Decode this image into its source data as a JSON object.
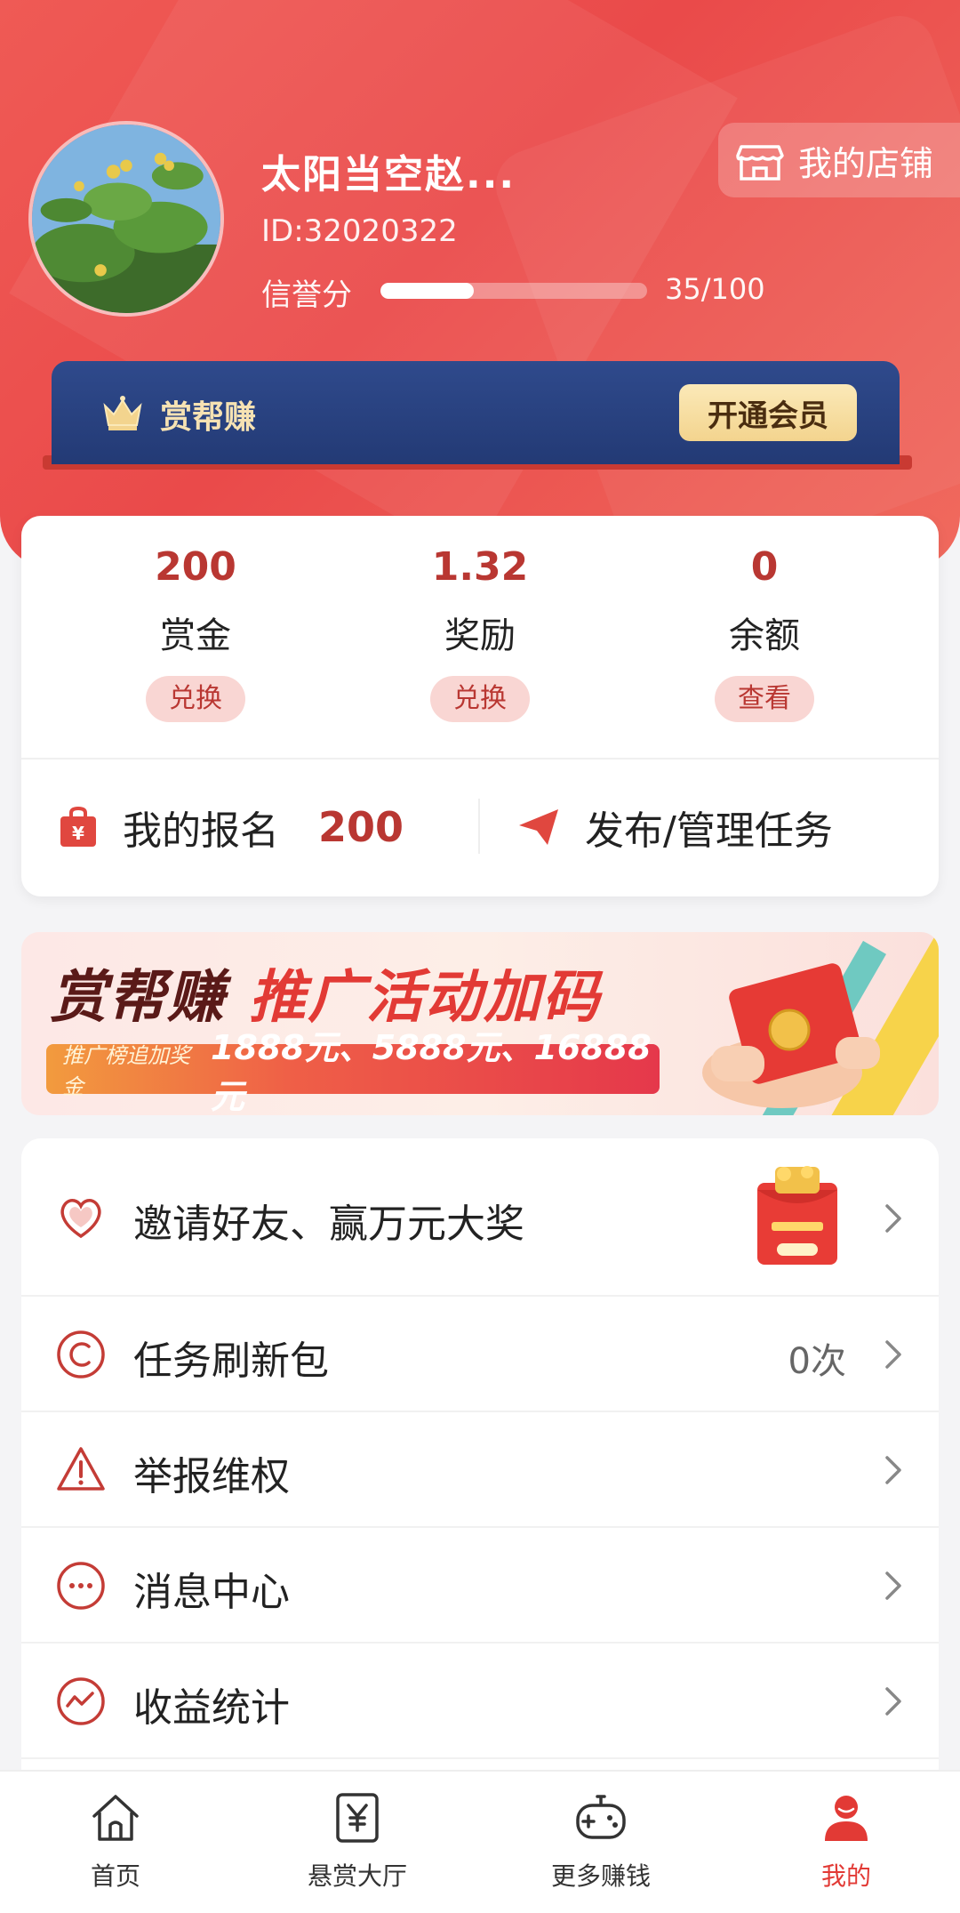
{
  "profile": {
    "username": "太阳当空赵...",
    "user_id": "ID:32020322",
    "credit_label": "信誉分",
    "credit_score": 35,
    "credit_max": 100,
    "credit_text": "35/100",
    "store_label": "我的店铺"
  },
  "vip": {
    "name": "赏帮赚",
    "button_label": "开通会员"
  },
  "stats": [
    {
      "value": "200",
      "label": "赏金",
      "action": "兑换"
    },
    {
      "value": "1.32",
      "label": "奖励",
      "action": "兑换"
    },
    {
      "value": "0",
      "label": "余额",
      "action": "查看"
    }
  ],
  "signup": {
    "label": "我的报名",
    "count": "200"
  },
  "publish": {
    "label": "发布/管理任务"
  },
  "promo": {
    "title_a": "赏帮赚",
    "title_b": "推广活动加码",
    "sub_prefix": "推广榜追加奖金",
    "sub_amounts": "1888元、5888元、16888元"
  },
  "menu": [
    {
      "label": "邀请好友、赢万元大奖",
      "value": "",
      "icon": "heart-icon"
    },
    {
      "label": "任务刷新包",
      "value": "0次",
      "icon": "refresh-icon"
    },
    {
      "label": "举报维权",
      "value": "",
      "icon": "warning-icon"
    },
    {
      "label": "消息中心",
      "value": "",
      "icon": "message-icon"
    },
    {
      "label": "收益统计",
      "value": "",
      "icon": "chart-icon"
    }
  ],
  "nav": [
    {
      "label": "首页",
      "icon": "home-icon",
      "active": false
    },
    {
      "label": "悬赏大厅",
      "icon": "yuan-icon",
      "active": false
    },
    {
      "label": "更多赚钱",
      "icon": "gamepad-icon",
      "active": false
    },
    {
      "label": "我的",
      "icon": "user-icon",
      "active": true
    }
  ],
  "colors": {
    "brand_red": "#e23a35",
    "header_red": "#ea4a4a",
    "vip_navy": "#233a75",
    "value_red": "#b93732"
  }
}
